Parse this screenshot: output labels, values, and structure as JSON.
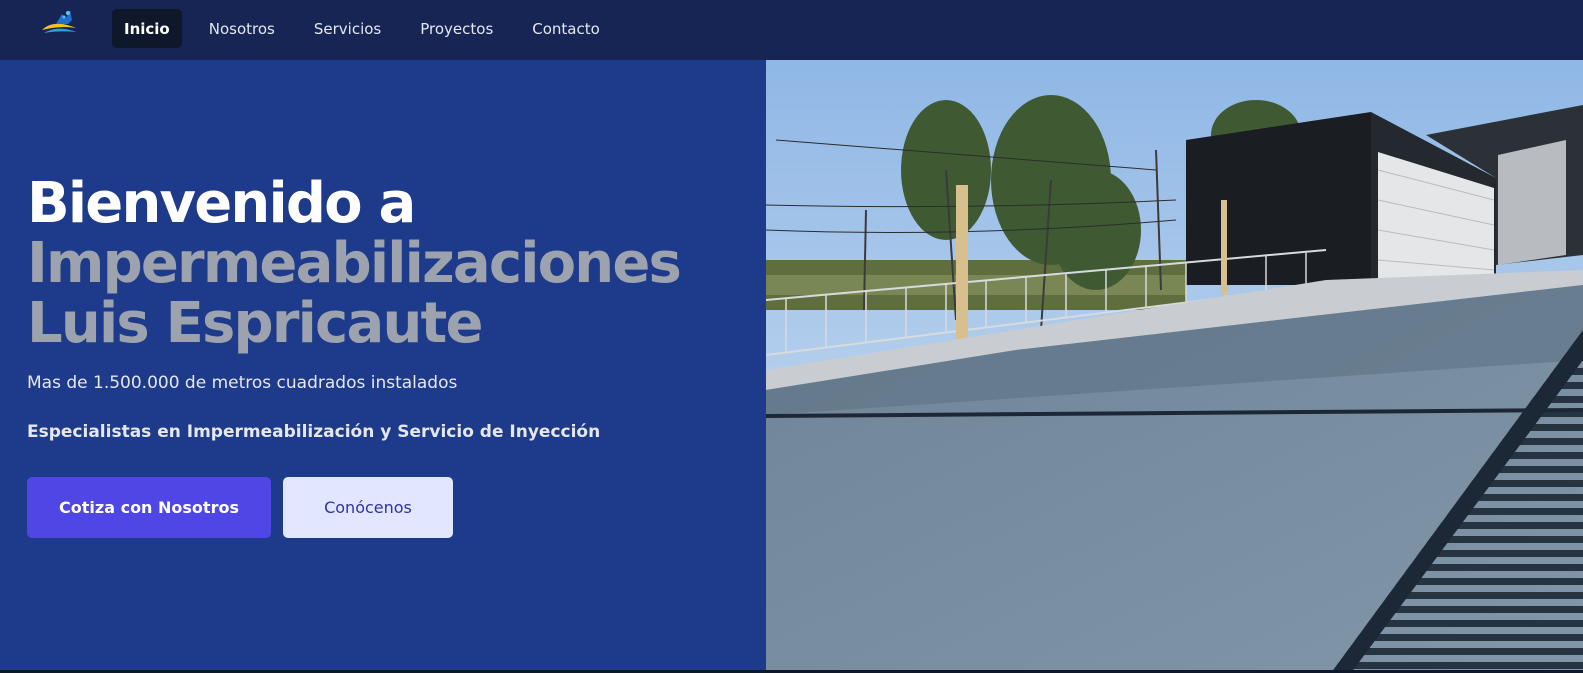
{
  "nav": {
    "items": [
      {
        "label": "Inicio",
        "active": true
      },
      {
        "label": "Nosotros",
        "active": false
      },
      {
        "label": "Servicios",
        "active": false
      },
      {
        "label": "Proyectos",
        "active": false
      },
      {
        "label": "Contacto",
        "active": false
      }
    ]
  },
  "hero": {
    "title_line1": "Bienvenido a",
    "title_line2": "Impermeabilizaciones",
    "title_line3": "Luis Espricaute",
    "subtitle": "Mas de 1.500.000 de metros cuadrados instalados",
    "tagline": "Especialistas en Impermeabilización y Servicio de Inyección",
    "primary_button": "Cotiza con Nosotros",
    "secondary_button": "Conócenos"
  },
  "colors": {
    "nav_bg": "#172554",
    "hero_bg": "#1e3a8a",
    "accent_text": "#9ca3af",
    "primary_button": "#4f46e5",
    "secondary_button": "#e0e7ff"
  },
  "icons": {
    "logo": "company-logo-icon"
  }
}
